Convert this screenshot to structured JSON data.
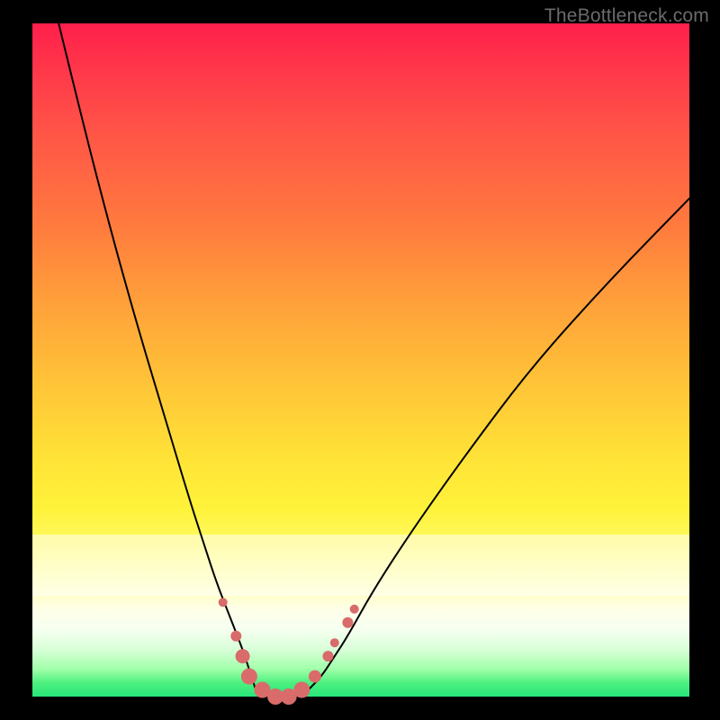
{
  "watermark": "TheBottleneck.com",
  "colors": {
    "frame": "#000000",
    "curve": "#000000",
    "marker": "#d96b6b",
    "gradient_top": "#ff1f4b",
    "gradient_mid": "#ffe437",
    "gradient_bottom": "#28e57a"
  },
  "chart_data": {
    "type": "line",
    "title": "",
    "xlabel": "",
    "ylabel": "",
    "xlim": [
      0,
      100
    ],
    "ylim": [
      0,
      100
    ],
    "note": "Bottleneck-style curve: y is bottleneck % (0 at valley). Two branches meeting at a flat valley around x≈34–42. Values are visual estimates from pixel positions (no axis ticks rendered).",
    "series": [
      {
        "name": "left-branch",
        "x": [
          4,
          8,
          12,
          16,
          20,
          24,
          26,
          28,
          30,
          32,
          33,
          34
        ],
        "y": [
          100,
          84,
          69,
          55,
          42,
          29,
          23,
          17,
          12,
          7,
          4,
          1
        ]
      },
      {
        "name": "valley",
        "x": [
          34,
          36,
          38,
          40,
          42
        ],
        "y": [
          1,
          0,
          0,
          0,
          1
        ]
      },
      {
        "name": "right-branch",
        "x": [
          42,
          44,
          46,
          48,
          52,
          58,
          66,
          76,
          88,
          100
        ],
        "y": [
          1,
          3,
          6,
          9,
          16,
          25,
          36,
          49,
          62,
          74
        ]
      }
    ],
    "markers": {
      "name": "highlighted-points",
      "note": "salmon dots clustered around the valley along the curve",
      "points": [
        {
          "x": 29,
          "y": 14,
          "r": 5
        },
        {
          "x": 31,
          "y": 9,
          "r": 6
        },
        {
          "x": 32,
          "y": 6,
          "r": 8
        },
        {
          "x": 33,
          "y": 3,
          "r": 9
        },
        {
          "x": 35,
          "y": 1,
          "r": 9
        },
        {
          "x": 37,
          "y": 0,
          "r": 9
        },
        {
          "x": 39,
          "y": 0,
          "r": 9
        },
        {
          "x": 41,
          "y": 1,
          "r": 9
        },
        {
          "x": 43,
          "y": 3,
          "r": 7
        },
        {
          "x": 45,
          "y": 6,
          "r": 6
        },
        {
          "x": 46,
          "y": 8,
          "r": 5
        },
        {
          "x": 48,
          "y": 11,
          "r": 6
        },
        {
          "x": 49,
          "y": 13,
          "r": 5
        }
      ]
    }
  }
}
